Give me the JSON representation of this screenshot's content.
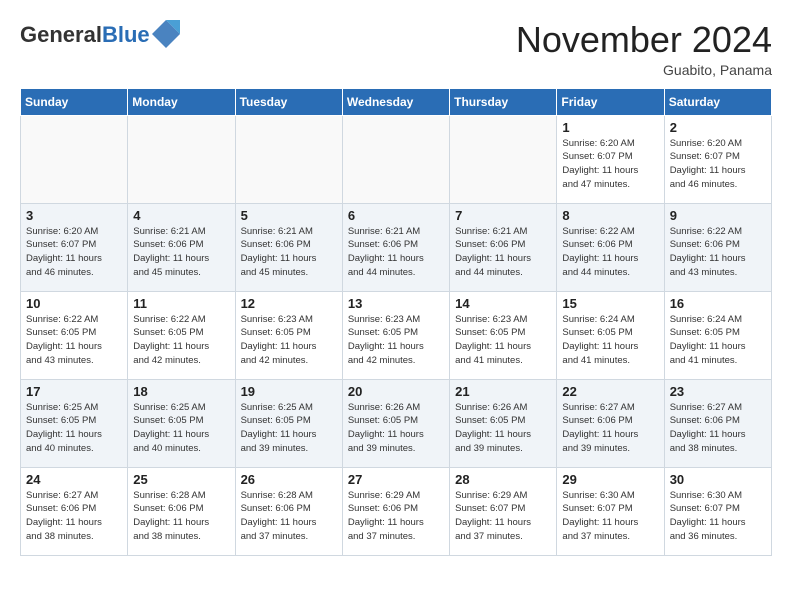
{
  "header": {
    "logo": {
      "general": "General",
      "blue": "Blue"
    },
    "month": "November 2024",
    "location": "Guabito, Panama"
  },
  "weekdays": [
    "Sunday",
    "Monday",
    "Tuesday",
    "Wednesday",
    "Thursday",
    "Friday",
    "Saturday"
  ],
  "weeks": [
    [
      {
        "day": "",
        "info": ""
      },
      {
        "day": "",
        "info": ""
      },
      {
        "day": "",
        "info": ""
      },
      {
        "day": "",
        "info": ""
      },
      {
        "day": "",
        "info": ""
      },
      {
        "day": "1",
        "info": "Sunrise: 6:20 AM\nSunset: 6:07 PM\nDaylight: 11 hours\nand 47 minutes."
      },
      {
        "day": "2",
        "info": "Sunrise: 6:20 AM\nSunset: 6:07 PM\nDaylight: 11 hours\nand 46 minutes."
      }
    ],
    [
      {
        "day": "3",
        "info": "Sunrise: 6:20 AM\nSunset: 6:07 PM\nDaylight: 11 hours\nand 46 minutes."
      },
      {
        "day": "4",
        "info": "Sunrise: 6:21 AM\nSunset: 6:06 PM\nDaylight: 11 hours\nand 45 minutes."
      },
      {
        "day": "5",
        "info": "Sunrise: 6:21 AM\nSunset: 6:06 PM\nDaylight: 11 hours\nand 45 minutes."
      },
      {
        "day": "6",
        "info": "Sunrise: 6:21 AM\nSunset: 6:06 PM\nDaylight: 11 hours\nand 44 minutes."
      },
      {
        "day": "7",
        "info": "Sunrise: 6:21 AM\nSunset: 6:06 PM\nDaylight: 11 hours\nand 44 minutes."
      },
      {
        "day": "8",
        "info": "Sunrise: 6:22 AM\nSunset: 6:06 PM\nDaylight: 11 hours\nand 44 minutes."
      },
      {
        "day": "9",
        "info": "Sunrise: 6:22 AM\nSunset: 6:06 PM\nDaylight: 11 hours\nand 43 minutes."
      }
    ],
    [
      {
        "day": "10",
        "info": "Sunrise: 6:22 AM\nSunset: 6:05 PM\nDaylight: 11 hours\nand 43 minutes."
      },
      {
        "day": "11",
        "info": "Sunrise: 6:22 AM\nSunset: 6:05 PM\nDaylight: 11 hours\nand 42 minutes."
      },
      {
        "day": "12",
        "info": "Sunrise: 6:23 AM\nSunset: 6:05 PM\nDaylight: 11 hours\nand 42 minutes."
      },
      {
        "day": "13",
        "info": "Sunrise: 6:23 AM\nSunset: 6:05 PM\nDaylight: 11 hours\nand 42 minutes."
      },
      {
        "day": "14",
        "info": "Sunrise: 6:23 AM\nSunset: 6:05 PM\nDaylight: 11 hours\nand 41 minutes."
      },
      {
        "day": "15",
        "info": "Sunrise: 6:24 AM\nSunset: 6:05 PM\nDaylight: 11 hours\nand 41 minutes."
      },
      {
        "day": "16",
        "info": "Sunrise: 6:24 AM\nSunset: 6:05 PM\nDaylight: 11 hours\nand 41 minutes."
      }
    ],
    [
      {
        "day": "17",
        "info": "Sunrise: 6:25 AM\nSunset: 6:05 PM\nDaylight: 11 hours\nand 40 minutes."
      },
      {
        "day": "18",
        "info": "Sunrise: 6:25 AM\nSunset: 6:05 PM\nDaylight: 11 hours\nand 40 minutes."
      },
      {
        "day": "19",
        "info": "Sunrise: 6:25 AM\nSunset: 6:05 PM\nDaylight: 11 hours\nand 39 minutes."
      },
      {
        "day": "20",
        "info": "Sunrise: 6:26 AM\nSunset: 6:05 PM\nDaylight: 11 hours\nand 39 minutes."
      },
      {
        "day": "21",
        "info": "Sunrise: 6:26 AM\nSunset: 6:05 PM\nDaylight: 11 hours\nand 39 minutes."
      },
      {
        "day": "22",
        "info": "Sunrise: 6:27 AM\nSunset: 6:06 PM\nDaylight: 11 hours\nand 39 minutes."
      },
      {
        "day": "23",
        "info": "Sunrise: 6:27 AM\nSunset: 6:06 PM\nDaylight: 11 hours\nand 38 minutes."
      }
    ],
    [
      {
        "day": "24",
        "info": "Sunrise: 6:27 AM\nSunset: 6:06 PM\nDaylight: 11 hours\nand 38 minutes."
      },
      {
        "day": "25",
        "info": "Sunrise: 6:28 AM\nSunset: 6:06 PM\nDaylight: 11 hours\nand 38 minutes."
      },
      {
        "day": "26",
        "info": "Sunrise: 6:28 AM\nSunset: 6:06 PM\nDaylight: 11 hours\nand 37 minutes."
      },
      {
        "day": "27",
        "info": "Sunrise: 6:29 AM\nSunset: 6:06 PM\nDaylight: 11 hours\nand 37 minutes."
      },
      {
        "day": "28",
        "info": "Sunrise: 6:29 AM\nSunset: 6:07 PM\nDaylight: 11 hours\nand 37 minutes."
      },
      {
        "day": "29",
        "info": "Sunrise: 6:30 AM\nSunset: 6:07 PM\nDaylight: 11 hours\nand 37 minutes."
      },
      {
        "day": "30",
        "info": "Sunrise: 6:30 AM\nSunset: 6:07 PM\nDaylight: 11 hours\nand 36 minutes."
      }
    ]
  ]
}
